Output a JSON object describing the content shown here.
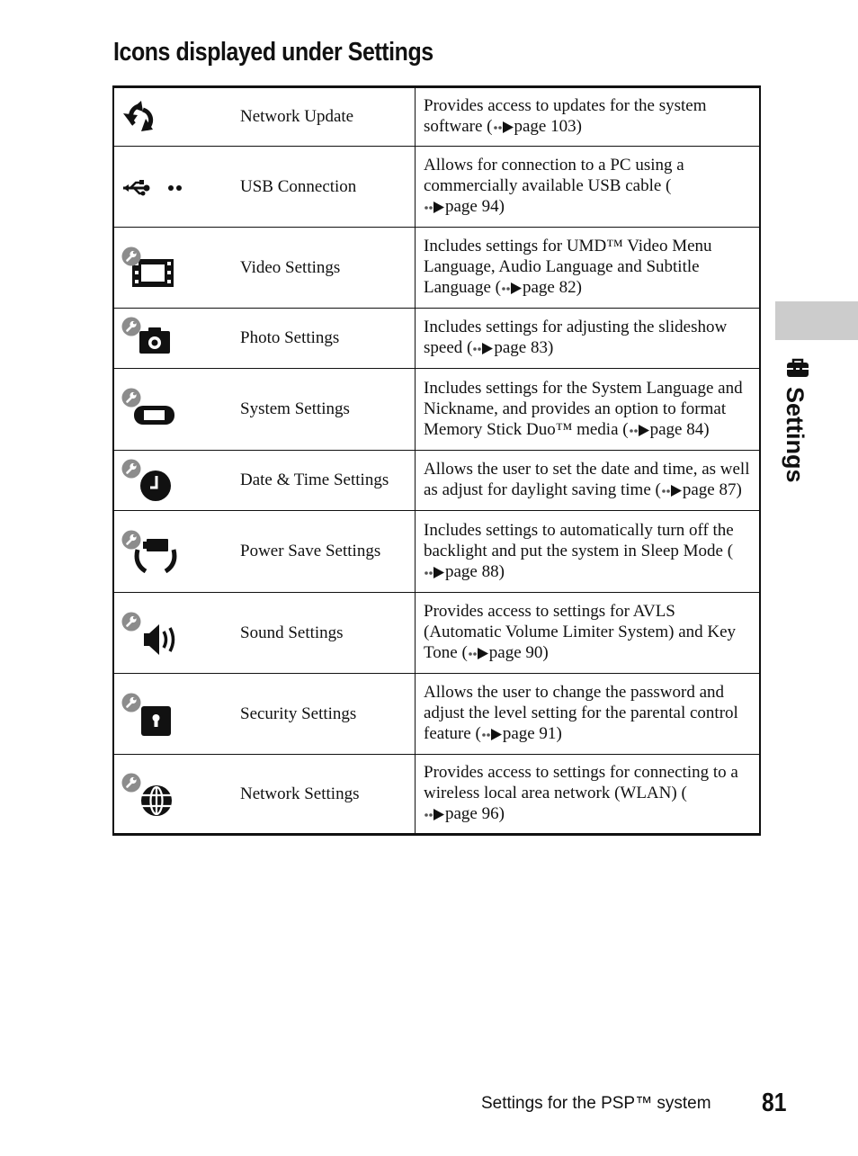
{
  "page": {
    "title": "Icons displayed under Settings",
    "side_tab_label": "Settings",
    "side_tab_icon": "toolbox-icon",
    "footer_text": "Settings for the PSP™ system",
    "page_number": "81"
  },
  "table": {
    "rows": [
      {
        "icon": "network-update-icon",
        "name": "Network Update",
        "desc": "Provides access to updates for the system software (",
        "page_ref": "page 103",
        "desc_end": ")"
      },
      {
        "icon": "usb-icon",
        "name": "USB Connection",
        "desc": "Allows for connection to a PC using a commercially available USB cable (",
        "page_ref": "page 94",
        "desc_end": ")"
      },
      {
        "icon": "video-settings-icon",
        "name": "Video Settings",
        "desc": "Includes settings for UMD™ Video Menu Language, Audio Language and Subtitle Language (",
        "page_ref": "page 82",
        "desc_end": ")"
      },
      {
        "icon": "photo-settings-icon",
        "name": "Photo Settings",
        "desc": "Includes settings for adjusting the slideshow speed (",
        "page_ref": "page 83",
        "desc_end": ")"
      },
      {
        "icon": "system-settings-icon",
        "name": "System Settings",
        "desc": "Includes settings for the System Language and Nickname, and provides an option to format Memory Stick Duo™ media (",
        "page_ref": "page 84",
        "desc_end": ")"
      },
      {
        "icon": "date-time-settings-icon",
        "name": "Date & Time Settings",
        "desc": "Allows the user to set the date and time, as well as adjust for daylight saving time (",
        "page_ref": "page 87",
        "desc_end": ")"
      },
      {
        "icon": "power-save-settings-icon",
        "name": "Power Save Settings",
        "desc": "Includes settings to automatically turn off the backlight and put the system in Sleep Mode (",
        "page_ref": "page 88",
        "desc_end": ")"
      },
      {
        "icon": "sound-settings-icon",
        "name": "Sound Settings",
        "desc": "Provides access to settings for AVLS (Automatic Volume Limiter System) and Key Tone (",
        "page_ref": "page 90",
        "desc_end": ")"
      },
      {
        "icon": "security-settings-icon",
        "name": "Security Settings",
        "desc": "Allows the user to change the password and adjust the level setting for the parental control feature (",
        "page_ref": "page 91",
        "desc_end": ")"
      },
      {
        "icon": "network-settings-icon",
        "name": "Network Settings",
        "desc": "Provides access to settings for connecting to a wireless local area network (WLAN) (",
        "page_ref": "page 96",
        "desc_end": ")"
      }
    ]
  },
  "colors": {
    "text": "#111111",
    "wrench_badge": "#8c8c8c",
    "side_tab": "#cccccc",
    "ref_arrow": "#555555"
  }
}
